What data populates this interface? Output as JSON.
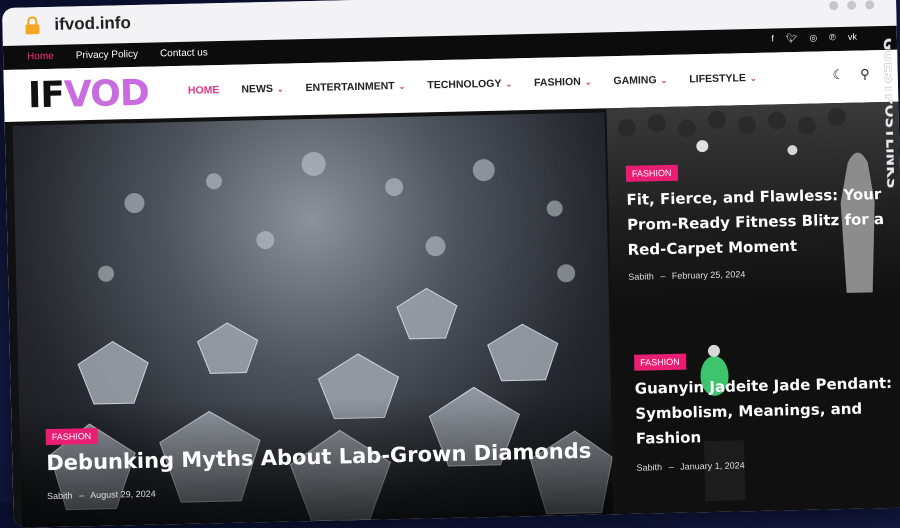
{
  "browser": {
    "url": "ifvod.info"
  },
  "topbar": {
    "links": [
      "Home",
      "Privacy Policy",
      "Contact us"
    ],
    "social_icons": [
      "facebook-icon",
      "twitter-icon",
      "instagram-icon",
      "pinterest-icon",
      "vk-icon"
    ]
  },
  "logo": {
    "part1": "IF",
    "part2": "VOD"
  },
  "nav": {
    "items": [
      {
        "label": "HOME",
        "dropdown": false
      },
      {
        "label": "NEWS",
        "dropdown": true
      },
      {
        "label": "ENTERTAINMENT",
        "dropdown": true
      },
      {
        "label": "TECHNOLOGY",
        "dropdown": true
      },
      {
        "label": "FASHION",
        "dropdown": true
      },
      {
        "label": "GAMING",
        "dropdown": true
      },
      {
        "label": "LIFESTYLE",
        "dropdown": true
      }
    ]
  },
  "featured": {
    "category": "FASHION",
    "title": "Debunking Myths About Lab-Grown Diamonds",
    "author": "Sabith",
    "date": "August 29, 2024"
  },
  "side_posts": [
    {
      "category": "FASHION",
      "title_line1": "Fit, Fierce, and Flawless: Your",
      "title_line2": "Prom-Ready Fitness Blitz for a",
      "title_line3": "Red-Carpet Moment",
      "author": "Sabith",
      "date": "February 25, 2024"
    },
    {
      "category": "FASHION",
      "title_line1": "Guanyin Jadeite Jade Pendant:",
      "title_line2": "Symbolism, Meanings, and",
      "title_line3": "Fashion",
      "author": "Sabith",
      "date": "January 1, 2024"
    }
  ],
  "watermark": {
    "text": "GUESTPOSTLINKS"
  },
  "colors": {
    "accent": "#e91e73",
    "logo_purple": "#c86ce0",
    "topbar_bg": "#0c0c0c"
  }
}
